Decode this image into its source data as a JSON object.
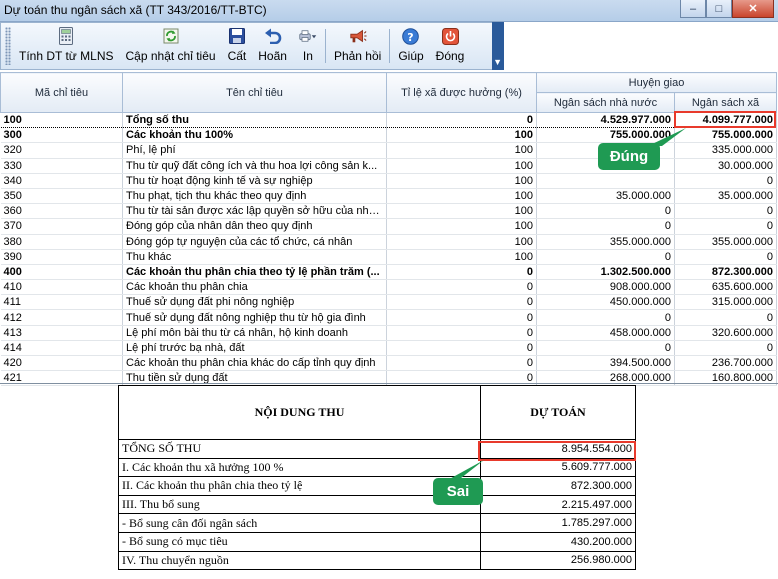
{
  "window": {
    "title": "Dự toán thu ngân sách xã (TT 343/2016/TT-BTC)",
    "min_label": "–",
    "max_label": "□",
    "close_label": "✕"
  },
  "toolbar": {
    "items": [
      {
        "label": "Tính DT từ MLNS",
        "icon": "calculator-icon"
      },
      {
        "label": "Cập nhật chỉ tiêu",
        "icon": "refresh-icon"
      },
      {
        "label": "Cất",
        "icon": "save-icon"
      },
      {
        "label": "Hoãn",
        "icon": "undo-icon"
      },
      {
        "label": "In",
        "icon": "printer-icon"
      },
      {
        "label": "Phản hồi",
        "icon": "megaphone-icon"
      },
      {
        "label": "Giúp",
        "icon": "help-icon"
      },
      {
        "label": "Đóng",
        "icon": "close-icon"
      }
    ]
  },
  "grid": {
    "headers": {
      "code": "Mã chỉ tiêu",
      "name": "Tên chỉ tiêu",
      "rate": "Tỉ lệ xã được hưởng (%)",
      "group": "Huyện giao",
      "state": "Ngân sách nhà nước",
      "commune": "Ngân sách xã"
    },
    "rows": [
      {
        "code": "100",
        "name": "Tổng số thu",
        "rate": "0",
        "state": "4.529.977.000",
        "commune": "4.099.777.000",
        "bold": true
      },
      {
        "code": "300",
        "name": "Các khoản thu 100%",
        "rate": "100",
        "state": "755.000.000",
        "commune": "755.000.000",
        "bold": true
      },
      {
        "code": "320",
        "name": "Phí, lệ phí",
        "rate": "100",
        "state": "",
        "commune": "335.000.000",
        "bold": false
      },
      {
        "code": "330",
        "name": "Thu từ quỹ đất công ích và thu hoa lợi công sản k...",
        "rate": "100",
        "state": "",
        "commune": "30.000.000",
        "bold": false
      },
      {
        "code": "340",
        "name": "Thu từ hoạt động kinh tế và sự nghiệp",
        "rate": "100",
        "state": "",
        "commune": "0",
        "bold": false
      },
      {
        "code": "350",
        "name": "Thu phạt, tịch thu khác theo quy định",
        "rate": "100",
        "state": "35.000.000",
        "commune": "35.000.000",
        "bold": false
      },
      {
        "code": "360",
        "name": "Thu từ tài sản được xác lập quyền sở hữu của nhà...",
        "rate": "100",
        "state": "0",
        "commune": "0",
        "bold": false
      },
      {
        "code": "370",
        "name": "Đóng góp của nhân dân theo quy định",
        "rate": "100",
        "state": "0",
        "commune": "0",
        "bold": false
      },
      {
        "code": "380",
        "name": "Đóng góp tự nguyện của các tổ chức, cá nhân",
        "rate": "100",
        "state": "355.000.000",
        "commune": "355.000.000",
        "bold": false
      },
      {
        "code": "390",
        "name": "Thu khác",
        "rate": "100",
        "state": "0",
        "commune": "0",
        "bold": false
      },
      {
        "code": "400",
        "name": "Các khoản thu phân chia theo tỷ lệ phần trăm (...",
        "rate": "0",
        "state": "1.302.500.000",
        "commune": "872.300.000",
        "bold": true
      },
      {
        "code": "410",
        "name": "Các khoản thu phân chia",
        "rate": "0",
        "state": "908.000.000",
        "commune": "635.600.000",
        "bold": false
      },
      {
        "code": "411",
        "name": "Thuế sử dụng đất phi nông nghiệp",
        "rate": "0",
        "state": "450.000.000",
        "commune": "315.000.000",
        "bold": false
      },
      {
        "code": "412",
        "name": "Thuế sử dụng đất nông nghiệp thu từ hộ gia đình",
        "rate": "0",
        "state": "0",
        "commune": "0",
        "bold": false
      },
      {
        "code": "413",
        "name": "Lệ phí môn bài thu từ cá nhân, hộ kinh doanh",
        "rate": "0",
        "state": "458.000.000",
        "commune": "320.600.000",
        "bold": false
      },
      {
        "code": "414",
        "name": "Lệ phí trước bạ nhà, đất",
        "rate": "0",
        "state": "0",
        "commune": "0",
        "bold": false
      },
      {
        "code": "420",
        "name": "Các khoản thu phân chia khác do cấp tỉnh quy định",
        "rate": "0",
        "state": "394.500.000",
        "commune": "236.700.000",
        "bold": false
      },
      {
        "code": "421",
        "name": "Thu tiền sử dụng đất",
        "rate": "0",
        "state": "268.000.000",
        "commune": "160.800.000",
        "bold": false
      }
    ]
  },
  "report": {
    "col_content": "NỘI DUNG THU",
    "col_amount": "DỰ TOÁN",
    "rows": [
      {
        "label": "TỔNG SỐ THU",
        "amount": "8.954.554.000"
      },
      {
        "label": "I. Các khoản thu xã hưởng 100 %",
        "amount": "5.609.777.000"
      },
      {
        "label": "II. Các khoản thu phân chia theo tỷ lệ",
        "amount": "872.300.000"
      },
      {
        "label": "III. Thu bổ sung",
        "amount": "2.215.497.000"
      },
      {
        "label": "- Bổ sung cân đối ngân sách",
        "amount": "1.785.297.000"
      },
      {
        "label": "- Bổ sung có mục tiêu",
        "amount": "430.200.000"
      },
      {
        "label": "IV. Thu chuyển nguồn",
        "amount": "256.980.000"
      }
    ]
  },
  "annotations": {
    "correct_label": "Đúng",
    "wrong_label": "Sai",
    "correct_color": "#1f9a53",
    "highlight_color": "#e83a2c"
  }
}
